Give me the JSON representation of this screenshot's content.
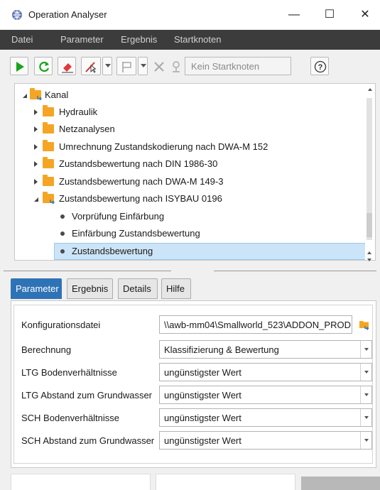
{
  "window": {
    "title": "Operation Analyser",
    "controls": {
      "minimize": "—",
      "maximize": "☐",
      "close": "✕"
    }
  },
  "menu": [
    {
      "label": "Datei"
    },
    {
      "label": "Parameter"
    },
    {
      "label": "Ergebnis"
    },
    {
      "label": "Startknoten"
    }
  ],
  "toolbar": {
    "startknoten_text": "Kein Startknoten",
    "help_glyph": "?",
    "icons": [
      "run-icon",
      "refresh-icon",
      "eraser-icon",
      "pick-tool-icon",
      "flag-icon",
      "cancel-icon",
      "location-pin-icon",
      "help-icon"
    ]
  },
  "tree": {
    "root": "Kanal",
    "items": [
      {
        "label": "Hydraulik"
      },
      {
        "label": "Netzanalysen"
      },
      {
        "label": "Umrechnung Zustandskodierung nach DWA-M 152"
      },
      {
        "label": "Zustandsbewertung nach DIN 1986-30"
      },
      {
        "label": "Zustandsbewertung nach DWA-M 149-3"
      },
      {
        "label": "Zustandsbewertung nach ISYBAU 0196"
      }
    ],
    "children": [
      {
        "label": "Vorprüfung Einfärbung"
      },
      {
        "label": "Einfärbung Zustandsbewertung"
      },
      {
        "label": "Zustandsbewertung",
        "selected": true
      }
    ]
  },
  "tabs": [
    {
      "label": "Parameter",
      "active": true
    },
    {
      "label": "Ergebnis"
    },
    {
      "label": "Details"
    },
    {
      "label": "Hilfe"
    }
  ],
  "parameters": [
    {
      "label": "Konfigurationsdatei",
      "value": "\\\\awb-mm04\\Smallworld_523\\ADDON_PROD",
      "kind": "path"
    },
    {
      "label": "Berechnung",
      "value": "Klassifizierung & Bewertung",
      "kind": "select"
    },
    {
      "label": "LTG Bodenverhältnisse",
      "value": "ungünstigster Wert",
      "kind": "select"
    },
    {
      "label": "LTG Abstand zum Grundwasser",
      "value": "ungünstigster Wert",
      "kind": "select"
    },
    {
      "label": "SCH Bodenverhältnisse",
      "value": "ungünstigster Wert",
      "kind": "select"
    },
    {
      "label": "SCH Abstand zum Grundwasser",
      "value": "ungünstigster Wert",
      "kind": "select"
    }
  ],
  "colors": {
    "menubar": "#3c3c3c",
    "active_tab": "#2f73b7",
    "selection": "#cce4f7",
    "folder": "#f5a524",
    "run_green": "#1aa31a"
  }
}
